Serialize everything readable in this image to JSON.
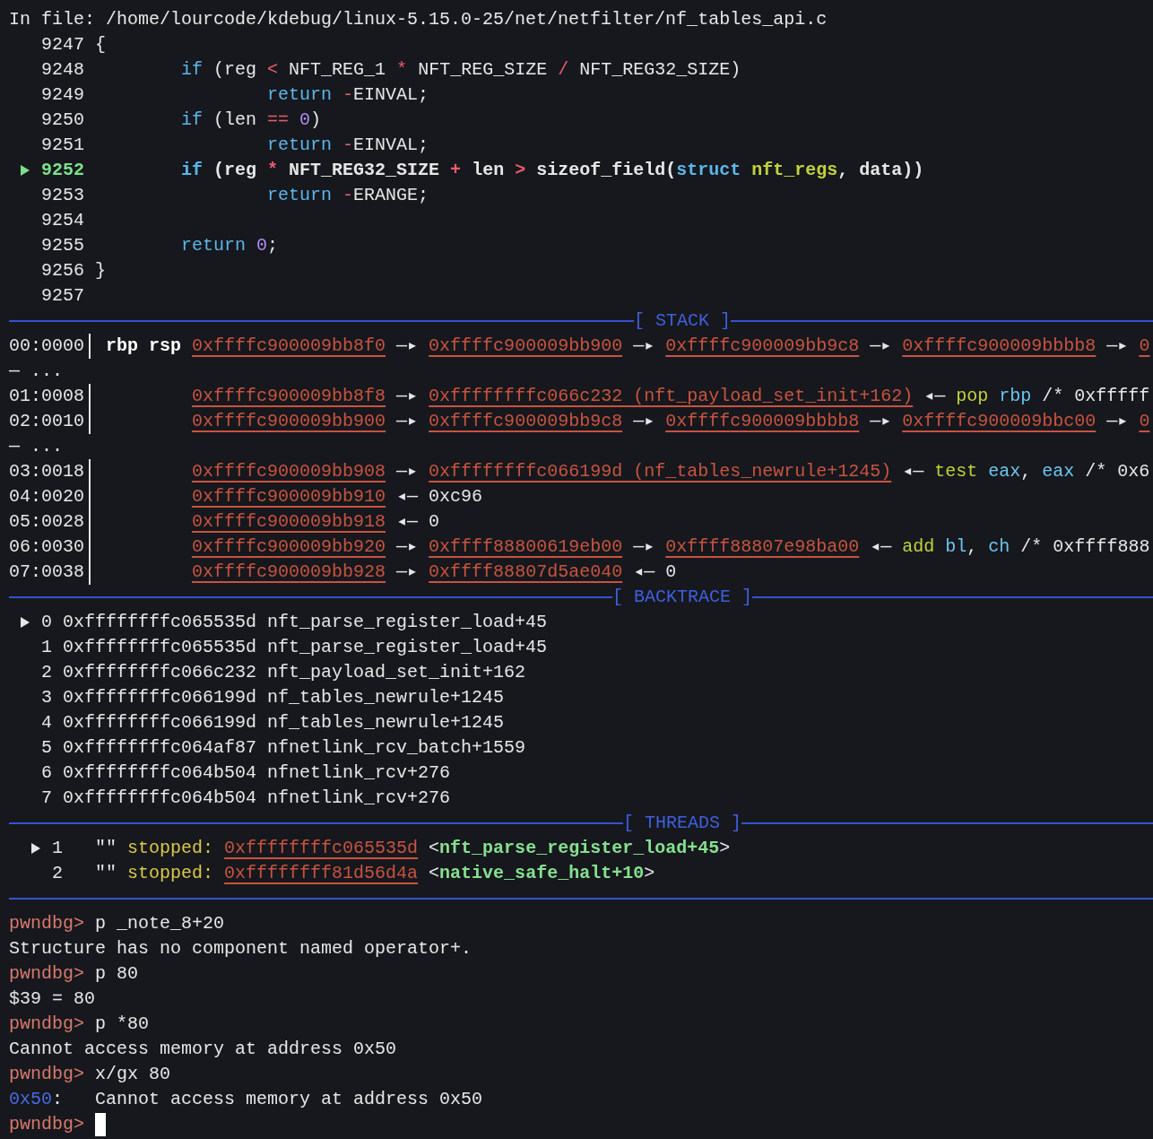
{
  "source": {
    "file_label": "In file: /home/lourcode/kdebug/linux-5.15.0-25/net/netfilter/nf_tables_api.c",
    "lines": [
      {
        "number": "9247",
        "current": false,
        "code": [
          {
            "text": "{",
            "kind": "plain"
          }
        ]
      },
      {
        "number": "9248",
        "current": false,
        "code": [
          {
            "text": "\tif",
            "kind": "keyword"
          },
          {
            "text": " (reg ",
            "kind": "plain"
          },
          {
            "text": "<",
            "kind": "operator"
          },
          {
            "text": " NFT_REG_1 ",
            "kind": "plain"
          },
          {
            "text": "*",
            "kind": "operator"
          },
          {
            "text": " NFT_REG_SIZE ",
            "kind": "plain"
          },
          {
            "text": "/",
            "kind": "operator"
          },
          {
            "text": " NFT_REG32_SIZE)",
            "kind": "plain"
          }
        ]
      },
      {
        "number": "9249",
        "current": false,
        "code": [
          {
            "text": "\t\treturn ",
            "kind": "keyword"
          },
          {
            "text": "-",
            "kind": "operator"
          },
          {
            "text": "EINVAL;",
            "kind": "plain"
          }
        ]
      },
      {
        "number": "9250",
        "current": false,
        "code": [
          {
            "text": "\tif",
            "kind": "keyword"
          },
          {
            "text": " (len ",
            "kind": "plain"
          },
          {
            "text": "==",
            "kind": "operator"
          },
          {
            "text": " 0",
            "kind": "number"
          },
          {
            "text": ")",
            "kind": "plain"
          }
        ]
      },
      {
        "number": "9251",
        "current": false,
        "code": [
          {
            "text": "\t\treturn ",
            "kind": "keyword"
          },
          {
            "text": "-",
            "kind": "operator"
          },
          {
            "text": "EINVAL;",
            "kind": "plain"
          }
        ]
      },
      {
        "number": "9252",
        "current": true,
        "code": [
          {
            "text": "\tif",
            "kind": "keyword"
          },
          {
            "text": " (reg ",
            "kind": "plain"
          },
          {
            "text": "*",
            "kind": "operator"
          },
          {
            "text": " NFT_REG32_SIZE ",
            "kind": "plain"
          },
          {
            "text": "+",
            "kind": "operator"
          },
          {
            "text": " len ",
            "kind": "plain"
          },
          {
            "text": ">",
            "kind": "operator"
          },
          {
            "text": " sizeof_field(",
            "kind": "plain"
          },
          {
            "text": "struct ",
            "kind": "keyword"
          },
          {
            "text": "nft_regs",
            "kind": "type"
          },
          {
            "text": ", data))",
            "kind": "plain"
          }
        ]
      },
      {
        "number": "9253",
        "current": false,
        "code": [
          {
            "text": "\t\treturn ",
            "kind": "keyword"
          },
          {
            "text": "-",
            "kind": "operator"
          },
          {
            "text": "ERANGE;",
            "kind": "plain"
          }
        ]
      },
      {
        "number": "9254",
        "current": false
      },
      {
        "number": "9255",
        "current": false,
        "code": [
          {
            "text": "\treturn ",
            "kind": "keyword"
          },
          {
            "text": "0",
            "kind": "number"
          },
          {
            "text": ";",
            "kind": "plain"
          }
        ]
      },
      {
        "number": "9256",
        "current": false,
        "code": [
          {
            "text": "}",
            "kind": "plain"
          }
        ]
      },
      {
        "number": "9257",
        "current": false
      }
    ]
  },
  "stack": {
    "title": "[ STACK ]",
    "rows": [
      {
        "kind": "entry",
        "offset": "00:0000",
        "registers": "rbp rsp",
        "segments": [
          {
            "text": "0xffffc900009bb8f0",
            "kind": "address"
          },
          {
            "text": " —▸ ",
            "kind": "plain"
          },
          {
            "text": "0xffffc900009bb900",
            "kind": "address"
          },
          {
            "text": " —▸ ",
            "kind": "plain"
          },
          {
            "text": "0xffffc900009bb9c8",
            "kind": "address"
          },
          {
            "text": " —▸ ",
            "kind": "plain"
          },
          {
            "text": "0xffffc900009bbbb8",
            "kind": "address"
          },
          {
            "text": " —▸ ",
            "kind": "plain"
          },
          {
            "text": "0",
            "kind": "address"
          }
        ]
      },
      {
        "kind": "skip",
        "text": "— ..."
      },
      {
        "kind": "entry",
        "offset": "01:0008",
        "segments": [
          {
            "text": "0xffffc900009bb8f8",
            "kind": "address"
          },
          {
            "text": " —▸ ",
            "kind": "plain"
          },
          {
            "text": "0xffffffffc066c232 (nft_payload_set_init+162)",
            "kind": "address"
          },
          {
            "text": " ◂— ",
            "kind": "plain"
          },
          {
            "text": "pop ",
            "kind": "mnemonic"
          },
          {
            "text": "rbp",
            "kind": "register"
          },
          {
            "text": " /* 0xfffff",
            "kind": "plain"
          }
        ]
      },
      {
        "kind": "entry",
        "offset": "02:0010",
        "segments": [
          {
            "text": "0xffffc900009bb900",
            "kind": "address"
          },
          {
            "text": " —▸ ",
            "kind": "plain"
          },
          {
            "text": "0xffffc900009bb9c8",
            "kind": "address"
          },
          {
            "text": " —▸ ",
            "kind": "plain"
          },
          {
            "text": "0xffffc900009bbbb8",
            "kind": "address"
          },
          {
            "text": " —▸ ",
            "kind": "plain"
          },
          {
            "text": "0xffffc900009bbc00",
            "kind": "address"
          },
          {
            "text": " —▸ ",
            "kind": "plain"
          },
          {
            "text": "0",
            "kind": "address"
          }
        ]
      },
      {
        "kind": "skip",
        "text": "— ..."
      },
      {
        "kind": "entry",
        "offset": "03:0018",
        "segments": [
          {
            "text": "0xffffc900009bb908",
            "kind": "address"
          },
          {
            "text": " —▸ ",
            "kind": "plain"
          },
          {
            "text": "0xffffffffc066199d (nf_tables_newrule+1245)",
            "kind": "address"
          },
          {
            "text": " ◂— ",
            "kind": "plain"
          },
          {
            "text": "test ",
            "kind": "mnemonic"
          },
          {
            "text": "eax",
            "kind": "register"
          },
          {
            "text": ", ",
            "kind": "plain"
          },
          {
            "text": "eax",
            "kind": "register"
          },
          {
            "text": " /* 0x6",
            "kind": "plain"
          }
        ]
      },
      {
        "kind": "entry",
        "offset": "04:0020",
        "segments": [
          {
            "text": "0xffffc900009bb910",
            "kind": "address"
          },
          {
            "text": " ◂— 0xc96",
            "kind": "plain"
          }
        ]
      },
      {
        "kind": "entry",
        "offset": "05:0028",
        "segments": [
          {
            "text": "0xffffc900009bb918",
            "kind": "address"
          },
          {
            "text": " ◂— 0",
            "kind": "plain"
          }
        ]
      },
      {
        "kind": "entry",
        "offset": "06:0030",
        "segments": [
          {
            "text": "0xffffc900009bb920",
            "kind": "address"
          },
          {
            "text": " —▸ ",
            "kind": "plain"
          },
          {
            "text": "0xffff88800619eb00",
            "kind": "address"
          },
          {
            "text": " —▸ ",
            "kind": "plain"
          },
          {
            "text": "0xffff88807e98ba00",
            "kind": "address"
          },
          {
            "text": " ◂— ",
            "kind": "plain"
          },
          {
            "text": "add ",
            "kind": "mnemonic"
          },
          {
            "text": "bl",
            "kind": "register"
          },
          {
            "text": ", ",
            "kind": "plain"
          },
          {
            "text": "ch",
            "kind": "register"
          },
          {
            "text": " /* 0xffff888",
            "kind": "plain"
          }
        ]
      },
      {
        "kind": "entry",
        "offset": "07:0038",
        "segments": [
          {
            "text": "0xffffc900009bb928",
            "kind": "address"
          },
          {
            "text": " —▸ ",
            "kind": "plain"
          },
          {
            "text": "0xffff88807d5ae040",
            "kind": "address"
          },
          {
            "text": " ◂— 0",
            "kind": "plain"
          }
        ]
      }
    ]
  },
  "backtrace": {
    "title": "[ BACKTRACE ]",
    "frames": [
      {
        "index": "0",
        "selected": true,
        "address": "0xffffffffc065535d",
        "symbol": "nft_parse_register_load+45"
      },
      {
        "index": "1",
        "selected": false,
        "address": "0xffffffffc065535d",
        "symbol": "nft_parse_register_load+45"
      },
      {
        "index": "2",
        "selected": false,
        "address": "0xffffffffc066c232",
        "symbol": "nft_payload_set_init+162"
      },
      {
        "index": "3",
        "selected": false,
        "address": "0xffffffffc066199d",
        "symbol": "nf_tables_newrule+1245"
      },
      {
        "index": "4",
        "selected": false,
        "address": "0xffffffffc066199d",
        "symbol": "nf_tables_newrule+1245"
      },
      {
        "index": "5",
        "selected": false,
        "address": "0xffffffffc064af87",
        "symbol": "nfnetlink_rcv_batch+1559"
      },
      {
        "index": "6",
        "selected": false,
        "address": "0xffffffffc064b504",
        "symbol": "nfnetlink_rcv+276"
      },
      {
        "index": "7",
        "selected": false,
        "address": "0xffffffffc064b504",
        "symbol": "nfnetlink_rcv+276"
      }
    ]
  },
  "threads": {
    "title": "[ THREADS ]",
    "items": [
      {
        "id": "1",
        "selected": true,
        "name": "\"\"",
        "state": "stopped:",
        "address": "0xffffffffc065535d",
        "open": "<",
        "symbol": "nft_parse_register_load+45",
        "close": ">"
      },
      {
        "id": "2",
        "selected": false,
        "name": "\"\"",
        "state": "stopped:",
        "address": "0xffffffff81d56d4a",
        "open": "<",
        "symbol": "native_safe_halt+10",
        "close": ">"
      }
    ]
  },
  "console": [
    {
      "kind": "command",
      "prompt": "pwndbg>",
      "text": "p _note_8+20"
    },
    {
      "kind": "output",
      "segments": [
        {
          "text": "Structure has no component named operator+.",
          "kind": "plain"
        }
      ]
    },
    {
      "kind": "command",
      "prompt": "pwndbg>",
      "text": "p 80"
    },
    {
      "kind": "output",
      "segments": [
        {
          "text": "$39 = 80",
          "kind": "plain"
        }
      ]
    },
    {
      "kind": "command",
      "prompt": "pwndbg>",
      "text": "p *80"
    },
    {
      "kind": "output",
      "segments": [
        {
          "text": "Cannot access memory at address 0x50",
          "kind": "plain"
        }
      ]
    },
    {
      "kind": "command",
      "prompt": "pwndbg>",
      "text": "x/gx 80"
    },
    {
      "kind": "output",
      "segments": [
        {
          "text": "0x50",
          "kind": "location"
        },
        {
          "text": ":   Cannot access memory at address 0x50",
          "kind": "plain"
        }
      ]
    },
    {
      "kind": "command",
      "prompt": "pwndbg>",
      "cursor": true
    }
  ]
}
